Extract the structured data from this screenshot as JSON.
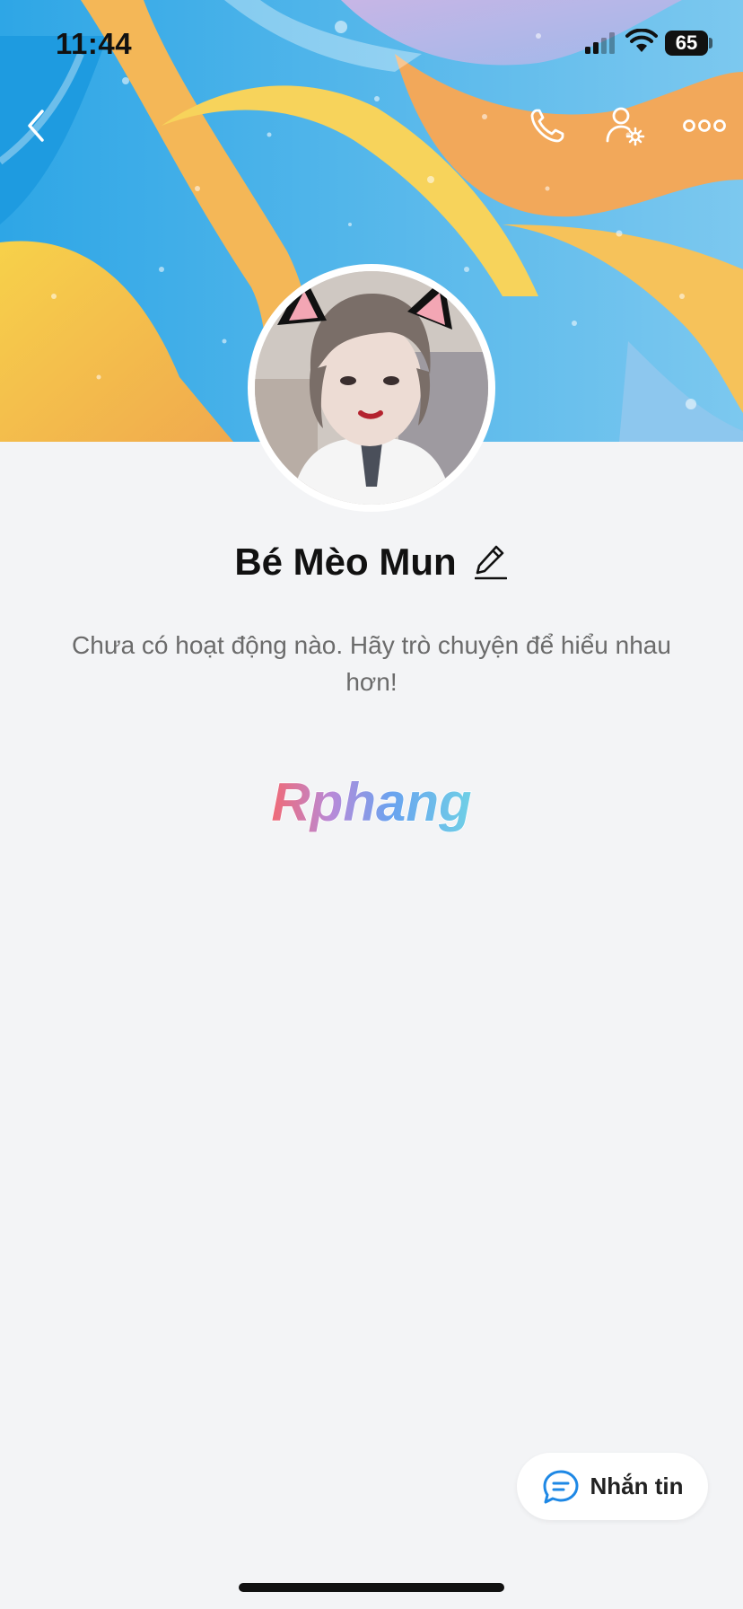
{
  "status_bar": {
    "time": "11:44",
    "battery": "65"
  },
  "profile": {
    "name": "Bé Mèo Mun",
    "activity_text": "Chưa có hoạt động nào. Hãy trò chuyện để hiểu nhau hơn!"
  },
  "watermark": {
    "text": "Rphang"
  },
  "actions": {
    "message_label": "Nhắn tin"
  },
  "icons": {
    "back": "chevron-left-icon",
    "call": "phone-icon",
    "settings": "user-settings-icon",
    "more": "more-dots-icon",
    "edit": "pencil-icon",
    "message": "chat-bubble-icon"
  },
  "colors": {
    "accent": "#1e88e5",
    "background": "#f3f4f6",
    "text": "#111111",
    "muted": "#6b6b6b"
  }
}
